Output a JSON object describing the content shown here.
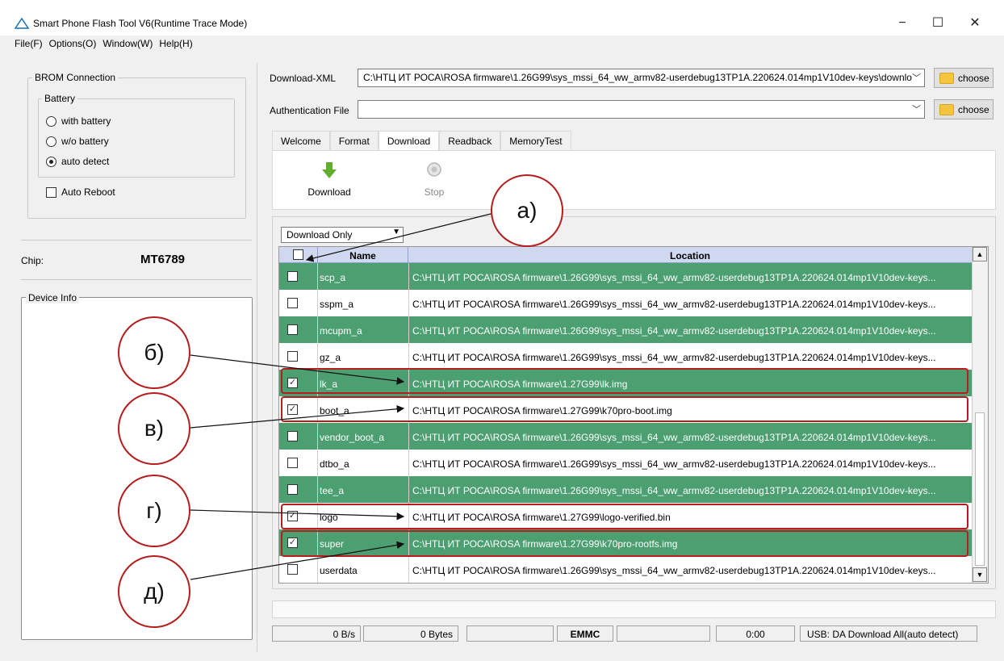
{
  "window": {
    "title": "Smart Phone Flash Tool V6(Runtime Trace Mode)",
    "minimize": "−",
    "maximize": "☐",
    "close": "✕"
  },
  "menu": [
    "File(F)",
    "Options(O)",
    "Window(W)",
    "Help(H)"
  ],
  "left": {
    "brom_title": "BROM Connection",
    "battery_title": "Battery",
    "radios": [
      {
        "label": "with battery",
        "selected": false
      },
      {
        "label": "w/o battery",
        "selected": false
      },
      {
        "label": "auto detect",
        "selected": true
      }
    ],
    "auto_reboot": "Auto Reboot",
    "chip_label": "Chip:",
    "chip_value": "MT6789",
    "device_info_title": "Device Info"
  },
  "top": {
    "download_xml_label": "Download-XML",
    "download_xml_value": "C:\\НТЦ ИТ РОСА\\ROSA firmware\\1.26G99\\sys_mssi_64_ww_armv82-userdebug13TP1A.220624.014mp1V10dev-keys\\downlo",
    "auth_label": "Authentication File",
    "auth_value": "",
    "choose": "choose"
  },
  "tabs": [
    "Welcome",
    "Format",
    "Download",
    "Readback",
    "MemoryTest"
  ],
  "toolbar": {
    "download": "Download",
    "stop": "Stop"
  },
  "mode_select": "Download Only",
  "table": {
    "headers": {
      "name": "Name",
      "location": "Location"
    },
    "rows": [
      {
        "name": "scp_a",
        "checked": false,
        "loc": "C:\\НТЦ ИТ РОСА\\ROSA firmware\\1.26G99\\sys_mssi_64_ww_armv82-userdebug13TP1A.220624.014mp1V10dev-keys..."
      },
      {
        "name": "sspm_a",
        "checked": false,
        "loc": "C:\\НТЦ ИТ РОСА\\ROSA firmware\\1.26G99\\sys_mssi_64_ww_armv82-userdebug13TP1A.220624.014mp1V10dev-keys..."
      },
      {
        "name": "mcupm_a",
        "checked": false,
        "loc": "C:\\НТЦ ИТ РОСА\\ROSA firmware\\1.26G99\\sys_mssi_64_ww_armv82-userdebug13TP1A.220624.014mp1V10dev-keys..."
      },
      {
        "name": "gz_a",
        "checked": false,
        "loc": "C:\\НТЦ ИТ РОСА\\ROSA firmware\\1.26G99\\sys_mssi_64_ww_armv82-userdebug13TP1A.220624.014mp1V10dev-keys..."
      },
      {
        "name": "lk_a",
        "checked": true,
        "loc": "C:\\НТЦ ИТ РОСА\\ROSA firmware\\1.27G99\\lk.img"
      },
      {
        "name": "boot_a",
        "checked": true,
        "loc": "C:\\НТЦ ИТ РОСА\\ROSA firmware\\1.27G99\\k70pro-boot.img"
      },
      {
        "name": "vendor_boot_a",
        "checked": false,
        "loc": "C:\\НТЦ ИТ РОСА\\ROSA firmware\\1.26G99\\sys_mssi_64_ww_armv82-userdebug13TP1A.220624.014mp1V10dev-keys..."
      },
      {
        "name": "dtbo_a",
        "checked": false,
        "loc": "C:\\НТЦ ИТ РОСА\\ROSA firmware\\1.26G99\\sys_mssi_64_ww_armv82-userdebug13TP1A.220624.014mp1V10dev-keys..."
      },
      {
        "name": "tee_a",
        "checked": false,
        "loc": "C:\\НТЦ ИТ РОСА\\ROSA firmware\\1.26G99\\sys_mssi_64_ww_armv82-userdebug13TP1A.220624.014mp1V10dev-keys..."
      },
      {
        "name": "logo",
        "checked": true,
        "loc": "C:\\НТЦ ИТ РОСА\\ROSA firmware\\1.27G99\\logo-verified.bin"
      },
      {
        "name": "super",
        "checked": true,
        "loc": "C:\\НТЦ ИТ РОСА\\ROSA firmware\\1.27G99\\k70pro-rootfs.img"
      },
      {
        "name": "userdata",
        "checked": false,
        "loc": "C:\\НТЦ ИТ РОСА\\ROSA firmware\\1.26G99\\sys_mssi_64_ww_armv82-userdebug13TP1A.220624.014mp1V10dev-keys..."
      }
    ]
  },
  "status": {
    "speed": "0 B/s",
    "bytes": "0 Bytes",
    "storage": "EMMC",
    "time": "0:00",
    "usb": "USB: DA Download All(auto detect)"
  },
  "annotations": {
    "a": "а)",
    "b": "б)",
    "v": "в)",
    "g": "г)",
    "d": "д)"
  },
  "colors": {
    "row_green": "#4c9f70",
    "annotation_red": "#b41e1e",
    "header_blue": "#cfd8ef"
  }
}
